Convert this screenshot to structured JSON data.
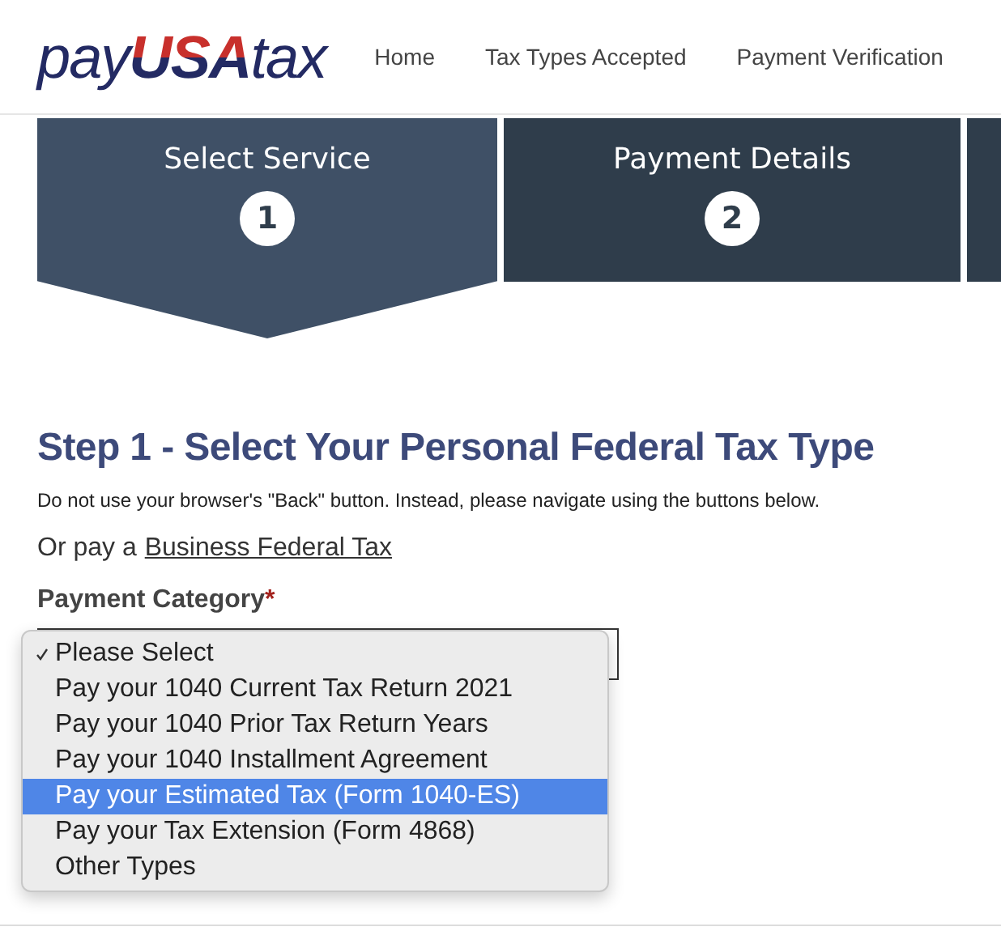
{
  "logo": {
    "parts": [
      "pay",
      "USA",
      "tax"
    ]
  },
  "nav": [
    "Home",
    "Tax Types Accepted",
    "Payment Verification"
  ],
  "steps": [
    {
      "label": "Select Service",
      "number": "1",
      "selected": true
    },
    {
      "label": "Payment Details",
      "number": "2",
      "selected": false
    }
  ],
  "heading": "Step 1 - Select Your Personal Federal Tax Type",
  "note": "Do not use your browser's \"Back\" button. Instead, please navigate using the buttons below.",
  "alt_prefix": "Or pay a",
  "alt_link": "Business Federal Tax",
  "field": {
    "label": "Payment Category",
    "required_mark": "*"
  },
  "options": [
    {
      "label": "Please Select",
      "checked": true,
      "selected": false
    },
    {
      "label": "Pay your 1040 Current Tax Return 2021",
      "checked": false,
      "selected": false
    },
    {
      "label": "Pay your 1040 Prior Tax Return Years",
      "checked": false,
      "selected": false
    },
    {
      "label": "Pay your 1040 Installment Agreement",
      "checked": false,
      "selected": false
    },
    {
      "label": "Pay your Estimated Tax (Form 1040-ES)",
      "checked": false,
      "selected": true
    },
    {
      "label": "Pay your Tax Extension (Form 4868)",
      "checked": false,
      "selected": false
    },
    {
      "label": "Other Types",
      "checked": false,
      "selected": false
    }
  ]
}
